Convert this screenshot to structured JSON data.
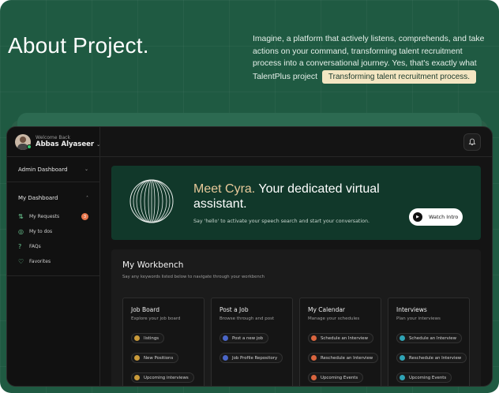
{
  "hero": {
    "title": "About Project.",
    "description": "Imagine, a  platform that actively listens, comprehends, and take actions on your command,  transforming talent recruitment process into a conversational journey. Yes, that's exactly what TalentPlus project",
    "pill": "Transforming talent recruitment process."
  },
  "user": {
    "welcome": "Welcome Back",
    "name": "Abbas Alyaseer"
  },
  "sidebar": {
    "admin_label": "Admin Dashboard",
    "my_dashboard_label": "My Dashboard",
    "items": [
      {
        "label": "My Requests",
        "icon": "requests-icon",
        "badge": "3"
      },
      {
        "label": "My to dos",
        "icon": "todo-icon"
      },
      {
        "label": "FAQs",
        "icon": "help-icon"
      },
      {
        "label": "Favorites",
        "icon": "heart-icon"
      }
    ]
  },
  "banner": {
    "highlight": "Meet Cyra.",
    "heading": " Your dedicated virtual assistant.",
    "subtext": "Say 'hello' to activate your speech search and start your conversation.",
    "watch_label": "Watch Intro"
  },
  "workbench": {
    "title": "My Workbench",
    "subtitle": "Say any keywords listed below to navigate through your workbench",
    "cards": [
      {
        "title": "Job Board",
        "subtitle": "Explore your job board",
        "color": "#c99a3a",
        "items": [
          "listings",
          "New Positions",
          "Upcoming interviews"
        ]
      },
      {
        "title": "Post a Job",
        "subtitle": "Browse through and post",
        "color": "#4a66c7",
        "items": [
          "Post a new job",
          "Job Profile Repository"
        ]
      },
      {
        "title": "My Calendar",
        "subtitle": "Manage your schedules",
        "color": "#d9653f",
        "items": [
          "Schedule an Interview",
          "Reschedule an Interview",
          "Upcoming Events"
        ]
      },
      {
        "title": "Interviews",
        "subtitle": "Plan your interviews",
        "color": "#2fa3b5",
        "items": [
          "Schedule an Interview",
          "Reschedule an Interview",
          "Upcoming Events"
        ]
      }
    ]
  },
  "colors": {
    "hero_bg": "#1f5a42",
    "app_bg": "#141414",
    "banner_bg": "#11382a",
    "accent": "#e8c99a"
  }
}
